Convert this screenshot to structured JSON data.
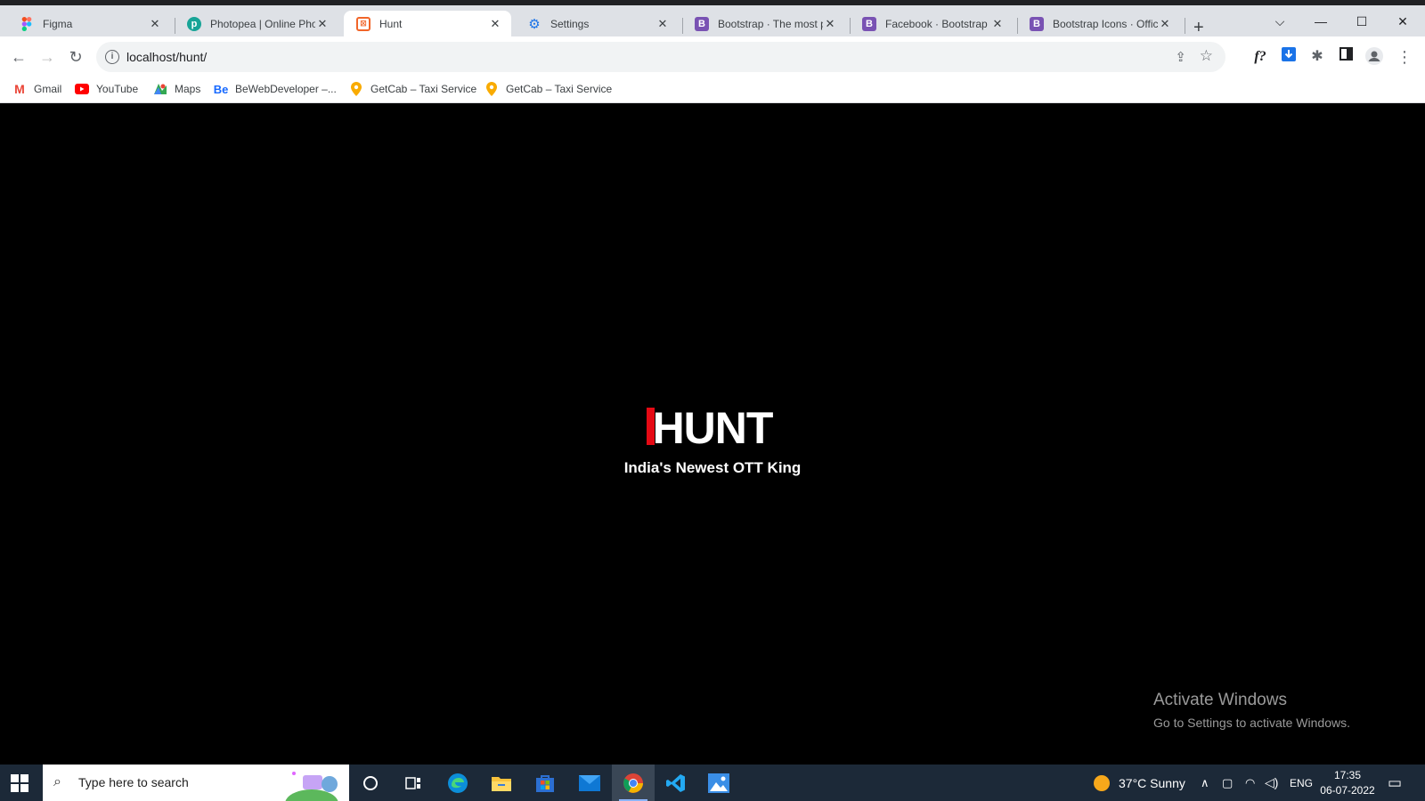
{
  "browser": {
    "tabs": [
      {
        "label": "Figma",
        "icon": "figma-icon"
      },
      {
        "label": "Photopea | Online Photo Editor",
        "icon": "photopea-icon"
      },
      {
        "label": "Hunt",
        "icon": "hunt-icon",
        "active": true
      },
      {
        "label": "Settings",
        "icon": "gear-icon"
      },
      {
        "label": "Bootstrap · The most popular HTML",
        "icon": "bootstrap-icon"
      },
      {
        "label": "Facebook · Bootstrap Icons",
        "icon": "bootstrap-icon"
      },
      {
        "label": "Bootstrap Icons · Official open source",
        "icon": "bootstrap-icon"
      }
    ],
    "new_tab_label": "+",
    "address": "localhost/hunt/",
    "bookmarks": [
      {
        "label": "Gmail",
        "icon": "gmail-icon"
      },
      {
        "label": "YouTube",
        "icon": "youtube-icon"
      },
      {
        "label": "Maps",
        "icon": "maps-icon"
      },
      {
        "label": "BeWebDeveloper –...",
        "icon": "behance-icon"
      },
      {
        "label": "GetCab – Taxi Service",
        "icon": "getcab-icon"
      },
      {
        "label": "GetCab – Taxi Service",
        "icon": "getcab-icon"
      }
    ]
  },
  "page": {
    "logo_text": "HUNT",
    "logo_accent_color": "#e50914",
    "tagline": "India's Newest OTT King"
  },
  "watermark": {
    "title": "Activate Windows",
    "subtitle": "Go to Settings to activate Windows."
  },
  "taskbar": {
    "search_placeholder": "Type here to search",
    "weather": "37°C  Sunny",
    "language": "ENG",
    "time": "17:35",
    "date": "06-07-2022"
  }
}
